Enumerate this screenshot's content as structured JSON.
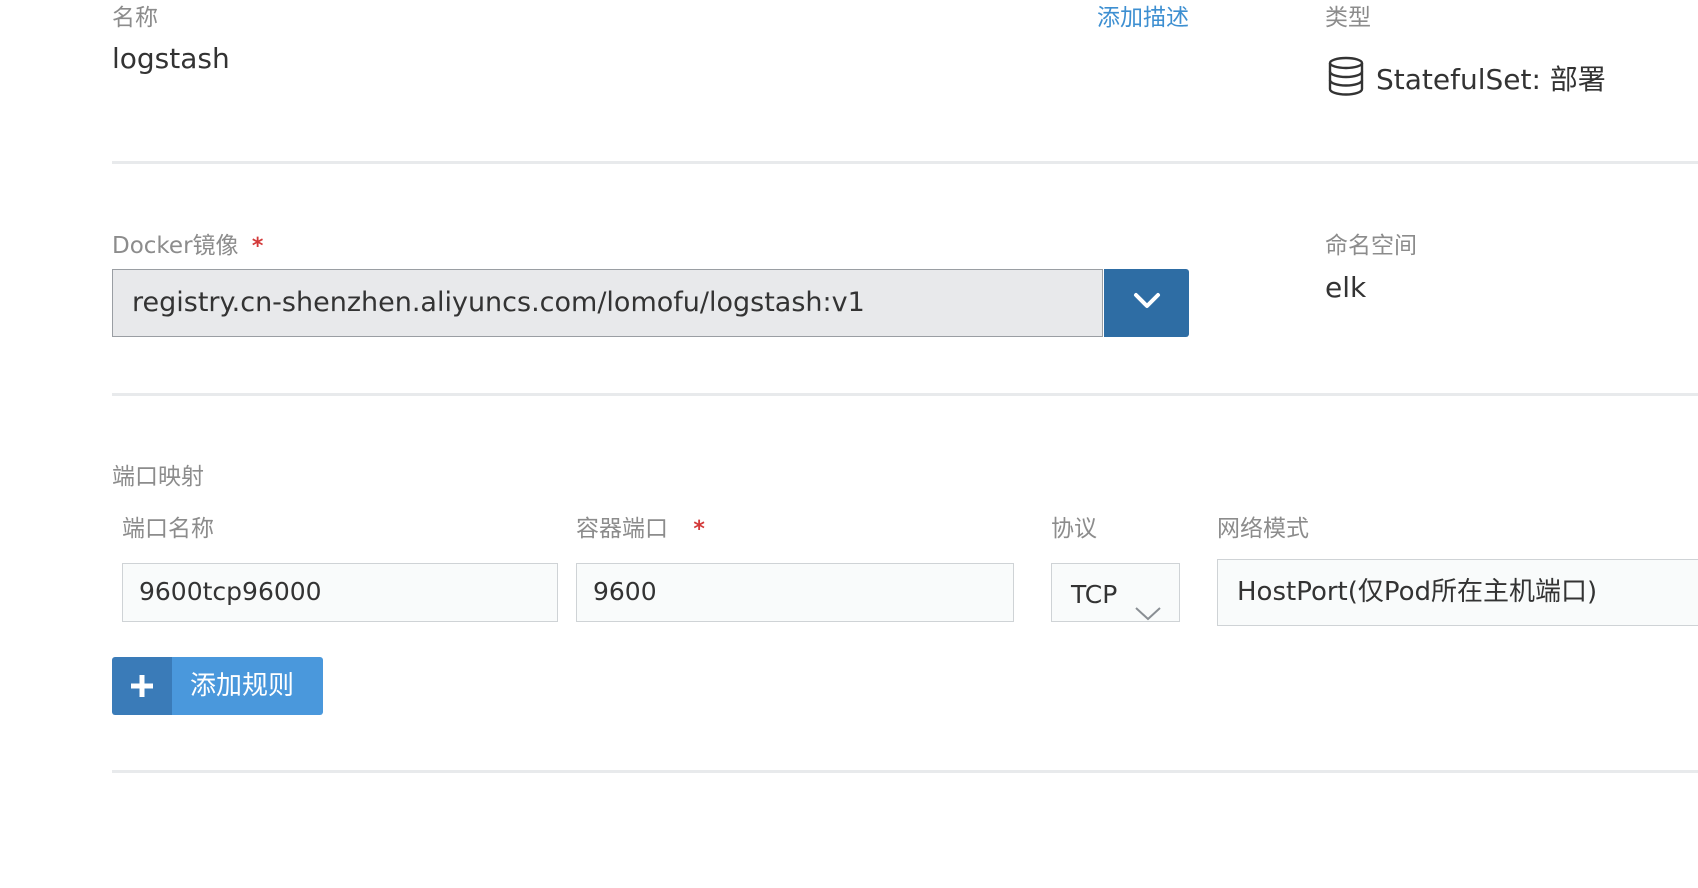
{
  "name_section": {
    "name_label": "名称",
    "name_value": "logstash",
    "add_description_link": "添加描述",
    "type_label": "类型",
    "type_value": "StatefulSet: 部署",
    "type_icon": "database-icon"
  },
  "image_section": {
    "docker_image_label": "Docker镜像",
    "required_mark": "*",
    "docker_image_value": "registry.cn-shenzhen.aliyuncs.com/lomofu/logstash:v1",
    "dropdown_icon": "chevron-down-icon",
    "namespace_label": "命名空间",
    "namespace_value": "elk"
  },
  "port_mapping": {
    "section_title": "端口映射",
    "columns": {
      "port_name": "端口名称",
      "container_port": "容器端口",
      "container_port_required": "*",
      "protocol": "协议",
      "network_mode": "网络模式"
    },
    "rows": [
      {
        "port_name": "9600tcp96000",
        "container_port": "9600",
        "protocol": "TCP",
        "network_mode": "HostPort(仅Pod所在主机端口)"
      }
    ],
    "add_rule_button": "添加规则",
    "add_rule_icon": "plus-icon"
  },
  "colors": {
    "primary_button": "#2e6da4",
    "add_button": "#4a98dc",
    "link": "#3d8fd1",
    "required": "#d33a3a"
  }
}
